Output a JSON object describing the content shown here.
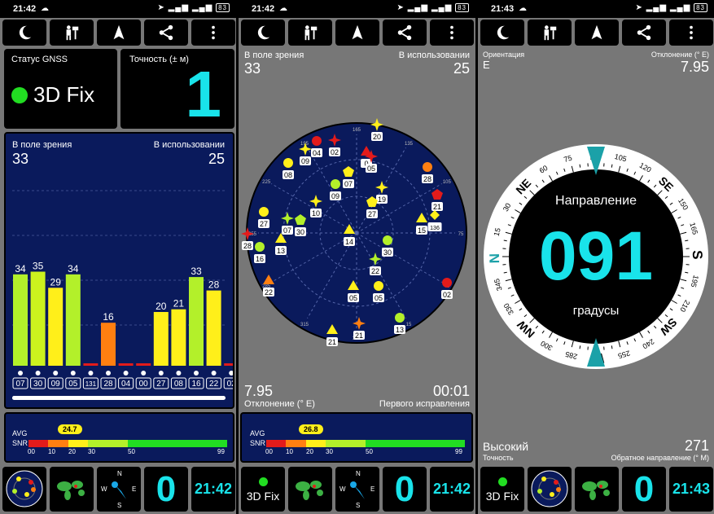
{
  "panels": [
    {
      "status": {
        "time": "21:42",
        "battery": "83"
      },
      "gnss_status_label": "Статус GNSS",
      "fix_text": "3D Fix",
      "accuracy_label": "Точность (± м)",
      "accuracy_value": "1",
      "in_view_label": "В поле зрения",
      "in_view_value": "33",
      "in_use_label": "В использовании",
      "in_use_value": "25",
      "avg_label": "AVG",
      "snr_label": "SNR",
      "avg_value": "24.7",
      "snr_ticks": [
        "00",
        "10",
        "20",
        "30",
        "50",
        "99"
      ],
      "bottom": {
        "value": "0",
        "time": "21:42"
      }
    },
    {
      "status": {
        "time": "21:42",
        "battery": "83"
      },
      "in_view_label": "В поле зрения",
      "in_view_value": "33",
      "in_use_label": "В использовании",
      "in_use_value": "25",
      "declination_value": "7.95",
      "declination_label": "Отклонение (° E)",
      "ttff_value": "00:01",
      "ttff_label": "Первого исправления",
      "avg_label": "AVG",
      "snr_label": "SNR",
      "avg_value": "26.8",
      "snr_ticks": [
        "00",
        "10",
        "20",
        "30",
        "50",
        "99"
      ],
      "bottom": {
        "fix": "3D Fix",
        "value": "0",
        "time": "21:42"
      }
    },
    {
      "status": {
        "time": "21:43",
        "battery": "83"
      },
      "orientation_label": "Ориентация",
      "orientation_value": "E",
      "declination_label": "Отклонение (° E)",
      "declination_value": "7.95",
      "heading_label": "Направление",
      "heading_value": "091",
      "heading_unit": "градусы",
      "accuracy_value": "Высокий",
      "accuracy_label": "Точность",
      "reverse_value": "271",
      "reverse_label": "Обратное направление (° M)",
      "bottom": {
        "fix": "3D Fix",
        "value": "0",
        "time": "21:43"
      }
    }
  ],
  "signal_bars": {
    "ids": [
      "07",
      "30",
      "09",
      "05",
      "131",
      "28",
      "04",
      "00",
      "27",
      "08",
      "16",
      "22",
      "02"
    ],
    "values": [
      34,
      35,
      29,
      34,
      0,
      16,
      0,
      0,
      20,
      21,
      33,
      28,
      0
    ],
    "labels": [
      "34",
      "35",
      "29",
      "34",
      "",
      "16",
      "",
      "",
      "20",
      "21",
      "33",
      "28",
      ""
    ],
    "colors": [
      "#b3f02a",
      "#ccf21e",
      "#ffef1a",
      "#b3f02a",
      "#e31b1b",
      "#ff7f11",
      "#e31b1b",
      "#e31b1b",
      "#ffef1a",
      "#ffef1a",
      "#b3f02a",
      "#ffef1a",
      "#e31b1b"
    ]
  },
  "sky_labels": {
    "ring_degrees": [
      "135",
      "105",
      "75",
      "45",
      "15",
      "345",
      "315",
      "285",
      "255",
      "225",
      "195",
      "165"
    ],
    "sats": [
      "20",
      "04",
      "02",
      "09",
      "0",
      "05",
      "08",
      "28",
      "07",
      "09",
      "19",
      "27",
      "21",
      "27",
      "10",
      "07",
      "30",
      "15",
      "136",
      "28",
      "14",
      "16",
      "13",
      "30",
      "22",
      "22",
      "02",
      "05",
      "05",
      "13",
      "21",
      "21"
    ]
  },
  "compass": {
    "cardinals": [
      "N",
      "NE",
      "E",
      "SE",
      "S",
      "SW",
      "W",
      "NW"
    ],
    "degrees": [
      "15",
      "30",
      "60",
      "75",
      "105",
      "120",
      "150",
      "165",
      "195",
      "210",
      "240",
      "255",
      "285",
      "300",
      "330",
      "345"
    ]
  }
}
